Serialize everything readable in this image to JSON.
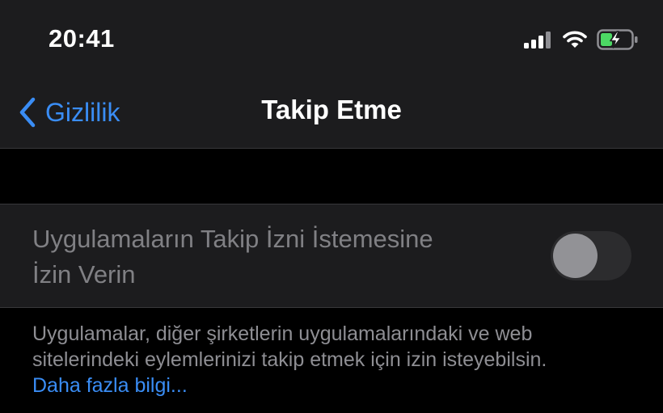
{
  "status_bar": {
    "time": "20:41",
    "icons": [
      "cellular-signal-icon",
      "wifi-icon",
      "battery-charging-icon"
    ],
    "battery_color": "#4cd964"
  },
  "nav": {
    "back_label": "Gizlilik",
    "title": "Takip Etme",
    "accent_color": "#3a8df5"
  },
  "setting": {
    "label_line1": "Uygulamaların Takip İzni İstemesine",
    "label_line2": "İzin Verin",
    "toggle_on": false
  },
  "footer": {
    "line1": "Uygulamalar, diğer şirketlerin uygulamalarındaki ve web",
    "line2": "sitelerindeki eylemlerinizi takip etmek için izin isteyebilsin.",
    "link": "Daha fazla bilgi..."
  }
}
